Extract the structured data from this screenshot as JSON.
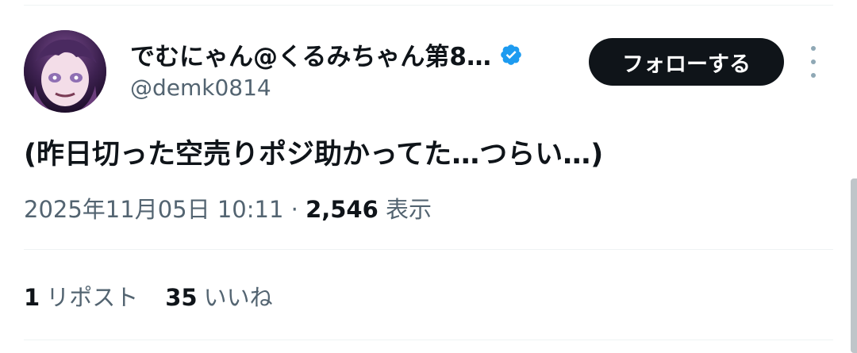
{
  "author": {
    "display_name": "でむにゃん@くるみちゃん第8…",
    "handle": "@demk0814",
    "verified": true
  },
  "actions": {
    "follow_label": "フォローする",
    "more_icon": "more-vertical-icon"
  },
  "tweet": {
    "text": "(昨日切った空売りポジ助かってた…つらい…)",
    "timestamp": "2025年11月05日 10:11",
    "separator": " · ",
    "views_count": "2,546",
    "views_label": "表示"
  },
  "stats": {
    "reposts_count": "1",
    "reposts_label": "リポスト",
    "likes_count": "35",
    "likes_label": "いいね"
  },
  "colors": {
    "text_primary": "#0f1419",
    "text_secondary": "#536471",
    "verified_blue": "#1d9bf0",
    "divider": "#eff3f4"
  }
}
